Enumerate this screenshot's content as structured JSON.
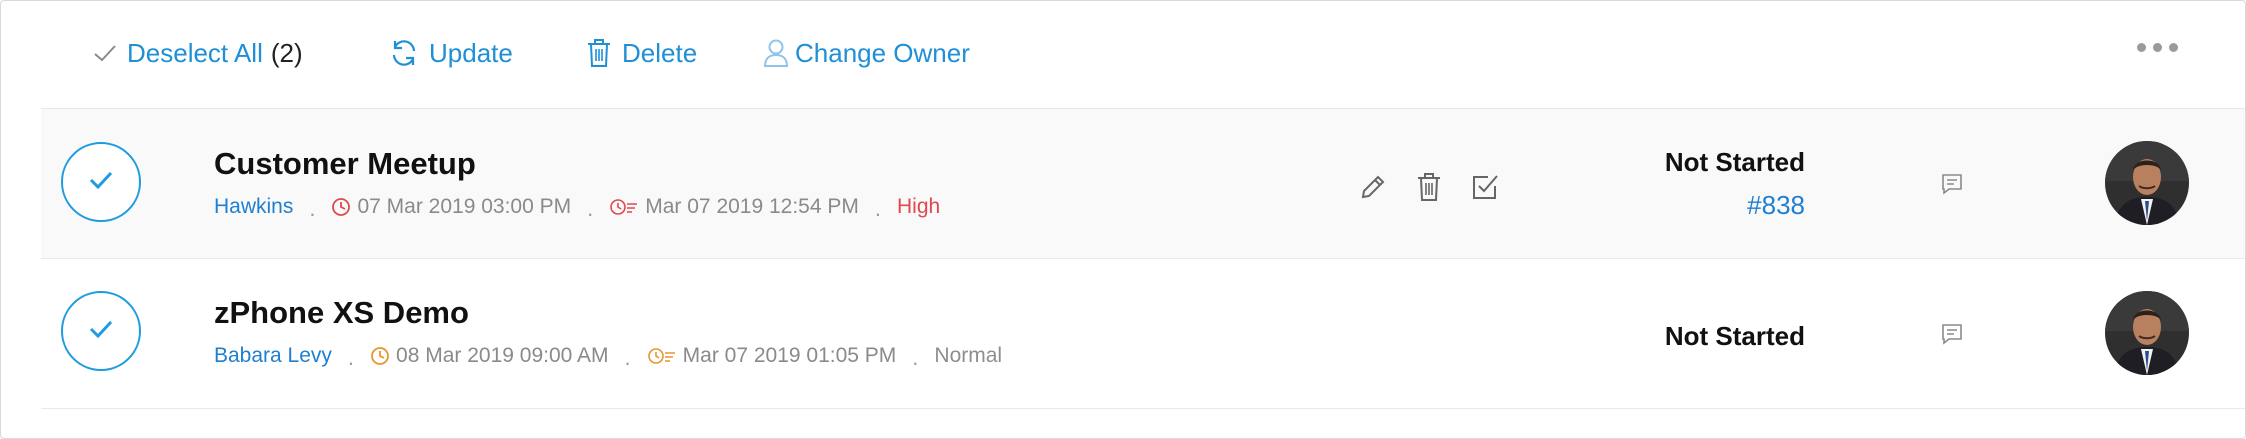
{
  "toolbar": {
    "deselect_label": "Deselect All",
    "selected_count": "(2)",
    "update_label": "Update",
    "delete_label": "Delete",
    "change_owner_label": "Change Owner",
    "more_icon": "more-horizontal-icon"
  },
  "colors": {
    "accent": "#1f8fd6",
    "link": "#1f7fd0",
    "priority_high": "#e0484f",
    "due_icon": "#e0484f",
    "due_icon_normal": "#e8962c"
  },
  "tasks": [
    {
      "title": "Customer Meetup",
      "contact": "Hawkins",
      "due_date": "07 Mar 2019 03:00 PM",
      "modified_date": "Mar 07 2019 12:54 PM",
      "priority": "High",
      "status": "Not Started",
      "ticket": "#838",
      "selected": true,
      "hover_actions": [
        "edit-icon",
        "delete-icon",
        "complete-icon"
      ]
    },
    {
      "title": "zPhone XS Demo",
      "contact": "Babara Levy",
      "due_date": "08 Mar 2019 09:00 AM",
      "modified_date": "Mar 07 2019 01:05 PM",
      "priority": "Normal",
      "status": "Not Started",
      "selected": true
    }
  ]
}
